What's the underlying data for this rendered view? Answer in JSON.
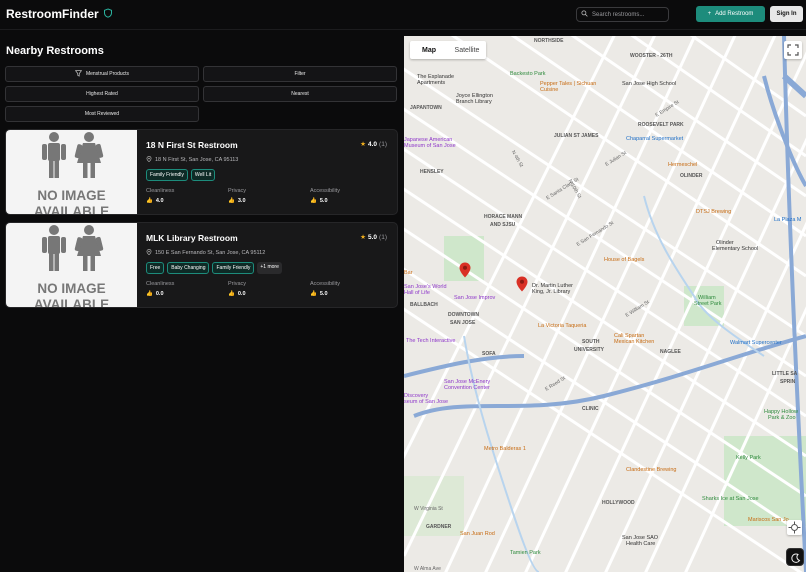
{
  "app": {
    "name": "RestroomFinder",
    "brand_icon": "shield-icon"
  },
  "header": {
    "search_placeholder": "Search restrooms...",
    "add_label": "Add Restroom",
    "signin_label": "Sign In"
  },
  "list": {
    "title": "Nearby Restrooms",
    "filters": {
      "menstrual": "Menstrual Products",
      "filter": "Filter",
      "highest_rated": "Highest Rated",
      "nearest": "Nearest",
      "most_reviewed": "Most Reviewed"
    },
    "no_image_line1": "NO IMAGE",
    "no_image_line2": "AVAILABLE",
    "metric_labels": {
      "cleanliness": "Cleanliness",
      "privacy": "Privacy",
      "accessibility": "Accessibility"
    },
    "restrooms": [
      {
        "name": "18 N First St Restroom",
        "rating": "4.0",
        "count": "(1)",
        "address": "18 N First St, San Jose, CA 95113",
        "tags": [
          "Family Friendly",
          "Well Lit"
        ],
        "more": "",
        "cleanliness": "4.0",
        "privacy": "3.0",
        "accessibility": "5.0"
      },
      {
        "name": "MLK Library Restroom",
        "rating": "5.0",
        "count": "(1)",
        "address": "150 E San Fernando St, San Jose, CA 95112",
        "tags": [
          "Free",
          "Baby Changing",
          "Family Friendly"
        ],
        "more": "+1 more",
        "cleanliness": "0.0",
        "privacy": "0.0",
        "accessibility": "5.0"
      }
    ]
  },
  "map": {
    "tabs": {
      "map": "Map",
      "satellite": "Satellite"
    },
    "neighborhoods": {
      "northside": "NORTHSIDE",
      "wooster": "WOOSTER - 26TH",
      "japantown": "JAPANTOWN",
      "roosevelt": "ROOSEVELT PARK",
      "julian": "JULIAN ST JAMES",
      "olinder": "OLINDER",
      "hensley": "HENSLEY",
      "horace": "HORACE MANN",
      "sjsu": "AND SJSU",
      "downtown": "DOWNTOWN",
      "sanjose": "SAN JOSE",
      "ballbach": "BALLBACH",
      "south": "SOUTH",
      "university": "UNIVERSITY",
      "naglee": "NAGLEE",
      "sofa": "SOFA",
      "clinic": "CLINIC",
      "hollywood": "HOLLYWOOD",
      "gardner": "GARDNER",
      "littlesaigon": "LITTLE SA",
      "spring": "SPRIN"
    },
    "pois": {
      "backesto": "Backesto Park",
      "peppertales": "Pepper Tales | Sichuan",
      "peppertales2": "Cuisine",
      "esplanade": "The Esplanade",
      "esplanade2": "Apartments",
      "joyce": "Joyce Ellington",
      "joyce2": "Branch Library",
      "sjhigh": "San Jose High School",
      "chaparral": "Chaparral Supermarket",
      "japanese": "Japanese American",
      "japanese2": "Museum of San Jose",
      "hermeschel": "Hermeschel",
      "dtsj": "DTSJ Brewing",
      "laplaza": "La Plaza M",
      "olinderschool": "Olinder",
      "olinderschool2": "Elementary School",
      "houseofbagels": "House of Bagels",
      "improv": "San Jose Improv",
      "mlk": "Dr. Martin Luther",
      "mlk2": "King, Jr. Library",
      "williampark": "William",
      "williampark2": "Street Park",
      "lavictoria": "La Victoria Taqueria",
      "calispartan": "Cali Spartan",
      "calispartan2": "Mexican Kitchen",
      "techinteractive": "The Tech Interactive",
      "walmart": "Walmart Supercenter",
      "mceneryconv": "San Jose McEnery",
      "mceneryconv2": "Convention Center",
      "discovery": "Discovery",
      "discovery2": "seum of San Jose",
      "happyhollow": "Happy Hollow",
      "happyhollow2": "Park & Zoo",
      "metroballeros": "Metro Balderas 1",
      "kellypark": "Kelly Park",
      "clandestine": "Clandestine Brewing",
      "sharksice": "Sharks Ice at San Jose",
      "mariscos": "Mariscos San Jo",
      "sanjuanrod": "San Juan Rod",
      "tamienpark": "Tamien Park",
      "sjsuvet": "San Jose SAO",
      "sjsuvet2": "Health Care",
      "spartan": "Spartan",
      "stoneonline": "Stone",
      "worldhall": "San Jose's World",
      "worldhall2": "Hall of Life",
      "kiwanis": "Kiwanis",
      "barstar": "Bar"
    },
    "streets": {
      "firstst": "N First St",
      "secondst": "N 2nd St",
      "fourthst": "N 4th St",
      "tenth": "N 10th St",
      "thirteenth": "N 13th St",
      "santaclara": "E Santa Clara St",
      "sanfernando": "E San Fernando St",
      "sansalvador": "E San Salvador St",
      "williamst": "E William St",
      "reedst": "E Reed St",
      "keyes": "Keyes St",
      "virginiast": "Virginia St",
      "westvirginia": "W Virginia St",
      "jacksonst": "E Jackson St",
      "taylorst": "E Taylor St",
      "mission": "E Mission St",
      "julianst": "E Julian St",
      "stjames": "E St James St",
      "empirest": "E Empire St",
      "hedding": "E Hedding St",
      "alma": "W Alma Ave",
      "tully": "Tully Rd"
    },
    "icons": {
      "fullscreen": "fullscreen-icon",
      "location": "location-icon",
      "theme": "moon-icon",
      "pin": "map-pin-icon"
    },
    "colors": {
      "accent": "#1d8c7c",
      "pin": "#d93025",
      "road": "#ffffff",
      "highway": "#8aa9d6",
      "park": "#cfe7cb",
      "water": "#b8d4ee"
    }
  }
}
